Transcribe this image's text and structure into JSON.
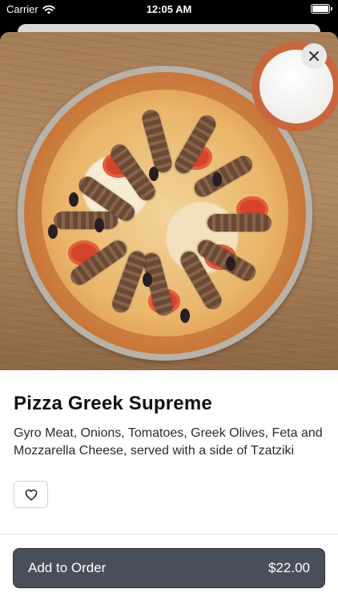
{
  "status_bar": {
    "carrier": "Carrier",
    "time": "12:05 AM"
  },
  "item": {
    "title": "Pizza Greek Supreme",
    "description": "Gyro Meat, Onions, Tomatoes, Greek Olives, Feta and Mozzarella Cheese, served with a side of Tzatziki"
  },
  "order": {
    "button_label": "Add to Order",
    "price": "$22.00"
  },
  "icons": {
    "close": "close-icon",
    "favorite": "heart-outline-icon",
    "wifi": "wifi-icon",
    "battery": "battery-icon"
  },
  "colors": {
    "primary_button": "#484f5a",
    "title_text": "#111111"
  }
}
